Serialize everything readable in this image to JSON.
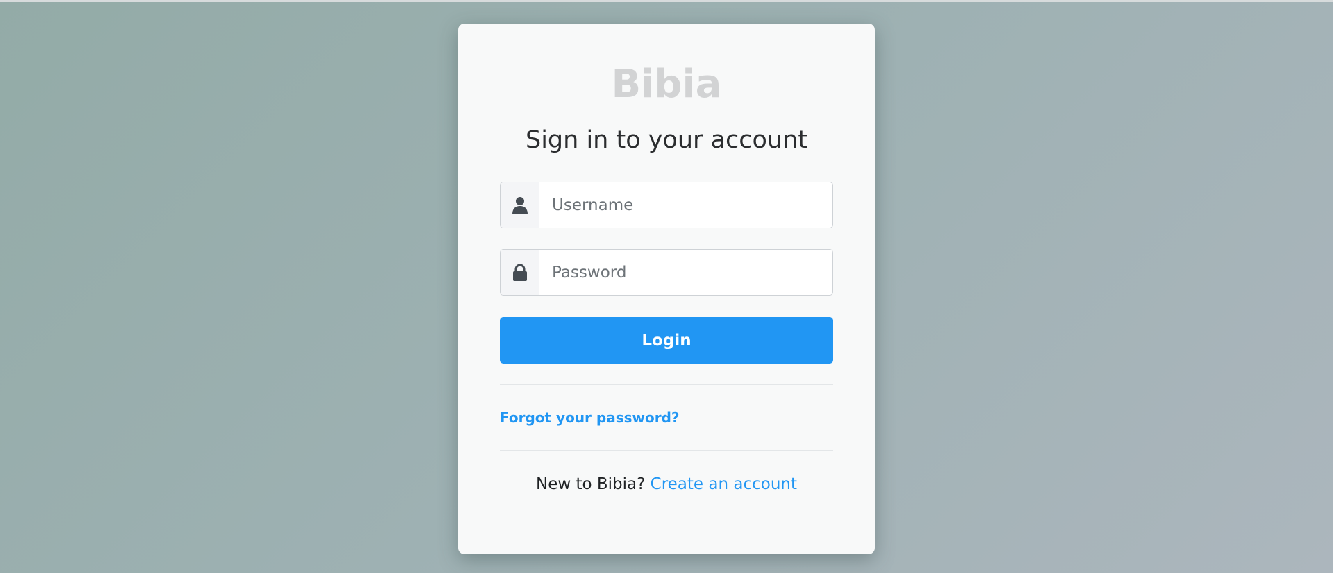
{
  "brand": "Bibia",
  "heading": "Sign in to your account",
  "username": {
    "icon": "user-icon",
    "placeholder": "Username",
    "value": ""
  },
  "password": {
    "icon": "lock-icon",
    "placeholder": "Password",
    "value": ""
  },
  "login_label": "Login",
  "forgot_label": "Forgot your password?",
  "signup": {
    "prompt": "New to Bibia?",
    "link_label": "Create an account"
  },
  "colors": {
    "accent": "#2196f3",
    "card_background": "#f8f9f9",
    "brand_text": "#d2d3d4",
    "heading_text": "#2b2d2f"
  }
}
